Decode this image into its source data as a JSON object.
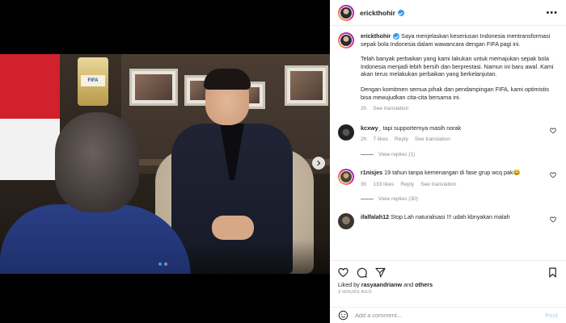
{
  "post": {
    "author": "erickthohir",
    "verified": true
  },
  "caption": {
    "username": "erickthohir",
    "p1": " Saya menjelaskan keseriusan Indonesia mentransformasi sepak bola Indonesia dalam wawancara dengan FIFA pagi ini.",
    "p2": "Telah banyak perbaikan yang kami lakukan untuk memajukan sepak bola Indonesia menjadi lebih bersih dan berprestasi. Namun ini baru awal. Kami akan terus melakukan perbaikan yang berkelanjutan.",
    "p3": "Dengan komitmen semua pihak dan pendampingan FIFA, kami optimistis bisa mewujudkan cita-cita bersama ini.",
    "time": "2h",
    "see_translation": "See translation"
  },
  "comments": [
    {
      "username": "kcxwy_",
      "text": " tapi supporternya masih norak",
      "time": "2h",
      "likes": "7 likes",
      "reply": "Reply",
      "see_translation": "See translation",
      "view_replies": "View replies (1)"
    },
    {
      "username": "r1nisjes",
      "text": " 19 tahun tanpa kemenangan di fase grup wcq pak😂",
      "time": "3h",
      "likes": "133 likes",
      "reply": "Reply",
      "see_translation": "See translation",
      "view_replies": "View replies (30)"
    },
    {
      "username": "ifalfalah12",
      "text": " Stop Lah naturalisasi !!! udah kbnyakan malah"
    }
  ],
  "footer": {
    "liked_by_prefix": "Liked by ",
    "liked_user": "rasyaandrianw",
    "liked_and": " and ",
    "liked_others": "others",
    "time_ago": "3 HOURS AGO",
    "add_comment_placeholder": "Add a comment...",
    "post_label": "Post"
  },
  "media": {
    "trophy_text": "FIFA",
    "dot_count": 2,
    "active_dot": 1
  },
  "colors": {
    "accent": "#3897f0",
    "post_disabled": "#b2dffc",
    "muted": "#8e8e8e"
  }
}
